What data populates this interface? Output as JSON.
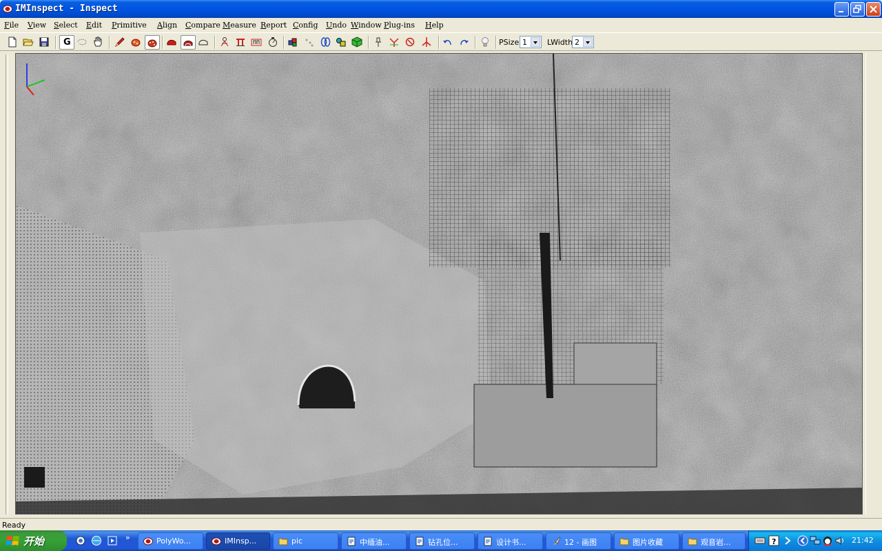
{
  "window": {
    "title": "IMInspect - Inspect"
  },
  "menu": [
    "File",
    "View",
    "Select",
    "Edit",
    "Primitive",
    "Align",
    "Compare",
    "Measure",
    "Report",
    "Config",
    "Undo",
    "Window",
    "Plug-ins",
    "Help"
  ],
  "toolbar": {
    "g_label": "G",
    "psize_label": "PSize",
    "psize_value": "1",
    "lwidth_label": "LWidth",
    "lwidth_value": "2"
  },
  "status": {
    "text": "Ready"
  },
  "taskbar": {
    "start_label": "开始",
    "tasks": [
      {
        "label": "PolyWo..."
      },
      {
        "label": "IMInsp..."
      },
      {
        "label": "pic"
      },
      {
        "label": "中缅油..."
      },
      {
        "label": "钻孔位..."
      },
      {
        "label": "设计书..."
      },
      {
        "label": "12 - 画图"
      },
      {
        "label": "图片收藏"
      },
      {
        "label": "观音岩..."
      }
    ],
    "clock": "21:42"
  },
  "colors": {
    "title_blue": "#0054e3",
    "taskbar_blue": "#2157d7",
    "start_green": "#35a235",
    "chrome": "#ece9d8"
  }
}
